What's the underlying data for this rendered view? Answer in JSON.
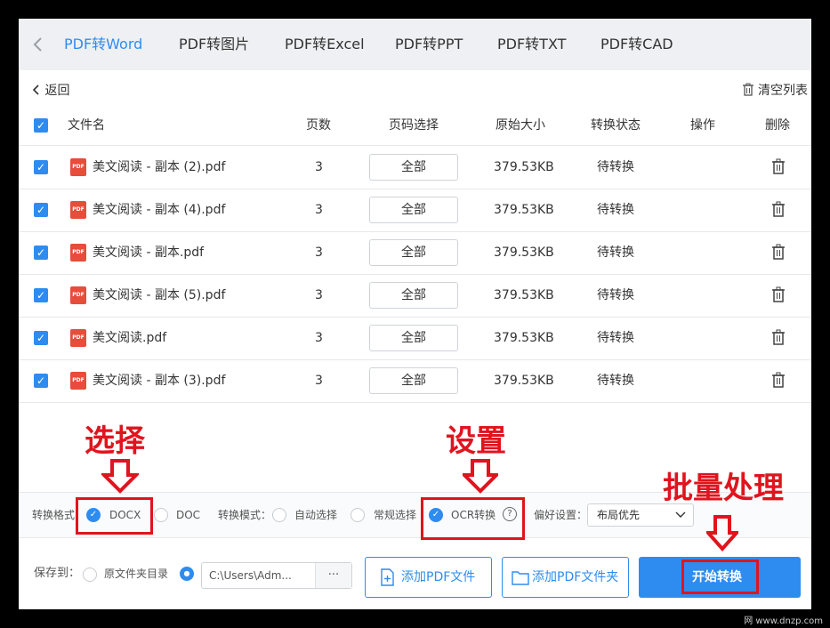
{
  "tabs": [
    {
      "label": "PDF转Word",
      "active": true
    },
    {
      "label": "PDF转图片"
    },
    {
      "label": "PDF转Excel"
    },
    {
      "label": "PDF转PPT"
    },
    {
      "label": "PDF转TXT"
    },
    {
      "label": "PDF转CAD"
    }
  ],
  "back_label": "返回",
  "clear_label": "清空列表",
  "columns": {
    "name": "文件名",
    "pages": "页数",
    "page_select": "页码选择",
    "size": "原始大小",
    "status": "转换状态",
    "action": "操作",
    "delete": "删除"
  },
  "rows": [
    {
      "name": "美文阅读 - 副本 (2).pdf",
      "pages": "3",
      "page_select": "全部",
      "size": "379.53KB",
      "status": "待转换"
    },
    {
      "name": "美文阅读 - 副本 (4).pdf",
      "pages": "3",
      "page_select": "全部",
      "size": "379.53KB",
      "status": "待转换"
    },
    {
      "name": "美文阅读 - 副本.pdf",
      "pages": "3",
      "page_select": "全部",
      "size": "379.53KB",
      "status": "待转换"
    },
    {
      "name": "美文阅读 - 副本 (5).pdf",
      "pages": "3",
      "page_select": "全部",
      "size": "379.53KB",
      "status": "待转换"
    },
    {
      "name": "美文阅读.pdf",
      "pages": "3",
      "page_select": "全部",
      "size": "379.53KB",
      "status": "待转换"
    },
    {
      "name": "美文阅读 - 副本 (3).pdf",
      "pages": "3",
      "page_select": "全部",
      "size": "379.53KB",
      "status": "待转换"
    }
  ],
  "pdf_icon_text": "PDF",
  "options": {
    "format_label": "转换格式：",
    "format_docx": "DOCX",
    "format_doc": "DOC",
    "mode_label": "转换模式：",
    "mode_auto": "自动选择",
    "mode_normal": "常规选择",
    "ocr": "OCR转换",
    "help": "?",
    "pref_label": "偏好设置：",
    "pref_value": "布局优先"
  },
  "save": {
    "label": "保存到：",
    "source_dir": "原文件夹目录",
    "path": "C:\\Users\\Adm...",
    "more": "···",
    "add_file": "添加PDF文件",
    "add_folder": "添加PDF文件夹",
    "start": "开始转换"
  },
  "annotations": {
    "select": "选择",
    "settings": "设置",
    "batch": "批量处理"
  },
  "watermark": "网 www.dnzp.com",
  "colors": {
    "accent": "#2e8cf0",
    "annotation_red": "#e0141e",
    "pdf_red": "#e74c3c"
  }
}
